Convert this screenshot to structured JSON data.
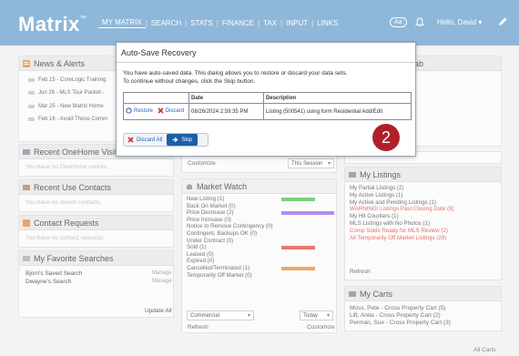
{
  "header": {
    "logo": "Matrix",
    "logo_mark": "™",
    "nav": [
      "MY MATRIX",
      "SEARCH",
      "STATS",
      "FINANCE",
      "TAX",
      "INPUT",
      "LINKS"
    ],
    "font_size_button": "Aa",
    "greeting": "Hello, David ▾"
  },
  "left": {
    "news": {
      "title": "News & Alerts",
      "items": [
        "Feb 15 - CoreLogic Training",
        "Jun 26 - MLS Tour Packet -",
        "Mar 25 - New Matrix Home",
        "Feb 16 - Avoid These Comm"
      ]
    },
    "visitors": {
      "title": "Recent OneHome Visitor",
      "text": "You have no OneHome visitors."
    },
    "contacts": {
      "title": "Recent Use Contacts",
      "text": "You have no recent contacts."
    },
    "requests": {
      "title": "Contact Requests",
      "text": "You have no contact requests."
    },
    "searches": {
      "title": "My Favorite Searches",
      "items": [
        {
          "name": "Bjorn's Saved Search",
          "action": "Manage"
        },
        {
          "name": "Dwayne's Search",
          "action": "Manage"
        }
      ],
      "update": "Update All"
    }
  },
  "middle": {
    "customize": "Customize",
    "session_select": "This Session",
    "market_watch": {
      "title": "Market Watch",
      "rows": [
        {
          "label": "New Listing (1)",
          "level": 0.63,
          "color": "#7fcf7f"
        },
        {
          "label": "Back On Market (0)",
          "level": 0,
          "color": ""
        },
        {
          "label": "Price Decrease (2)",
          "level": 1.0,
          "color": "#b08ef0"
        },
        {
          "label": "Price Increase (0)",
          "level": 0,
          "color": ""
        },
        {
          "label": "Notice to Remove Contingency (0)",
          "level": 0,
          "color": ""
        },
        {
          "label": "Contingent, Backups OK (0)",
          "level": 0,
          "color": ""
        },
        {
          "label": "Under Contract (0)",
          "level": 0,
          "color": ""
        },
        {
          "label": "Sold (1)",
          "level": 0.63,
          "color": "#e8776f"
        },
        {
          "label": "Leased (0)",
          "level": 0,
          "color": ""
        },
        {
          "label": "Expired (0)",
          "level": 0,
          "color": ""
        },
        {
          "label": "Cancelled/Terminated (1)",
          "level": 0.63,
          "color": "#f2a66a"
        },
        {
          "label": "Temporarily Off Market (0)",
          "level": 0,
          "color": ""
        }
      ],
      "type_select": "Commercial",
      "period_select": "Today",
      "refresh": "Refresh",
      "customize": "Customize"
    }
  },
  "right": {
    "tab_fragment": "ab",
    "my_listings": {
      "title": "My Listings",
      "items": [
        {
          "text": "My Partial Listings (2)",
          "alert": false
        },
        {
          "text": "My Active Listings (1)",
          "alert": false
        },
        {
          "text": "My Active and Pending Listings (1)",
          "alert": false
        },
        {
          "text": "WARNING! Listings Past Closing Date (8)",
          "alert": true
        },
        {
          "text": "My Hit Counters (1)",
          "alert": false
        },
        {
          "text": "MLS Listings with No Photos (1)",
          "alert": false
        },
        {
          "text": "Comp Solds Ready for MLS Review (2)",
          "alert": true
        },
        {
          "text": "All Temporarily Off Market Listings (29)",
          "alert": true
        }
      ],
      "refresh": "Refresh"
    },
    "my_carts": {
      "title": "My Carts",
      "items": [
        "Moss, Pete - Cross Property Cart (5)",
        "Lift, Anita - Cross Property Cart (2)",
        "Perman, Sue - Cross Property Cart (3)"
      ],
      "all": "All Carts"
    }
  },
  "dialog": {
    "title": "Auto-Save Recovery",
    "message_line1": "You have auto-saved data. This dialog allows you to restore or discard your data sets.",
    "message_line2": "To continue without changes, click the Skip button.",
    "columns": [
      "",
      "Date",
      "Description"
    ],
    "row": {
      "restore": "Restore",
      "discard": "Discard",
      "date": "08/26/2024 2:59:35 PM",
      "description": "Listing (500541) using form Residential Add/Edit"
    },
    "discard_all": "Discard All",
    "skip": "Skip"
  },
  "step_badge": "2"
}
